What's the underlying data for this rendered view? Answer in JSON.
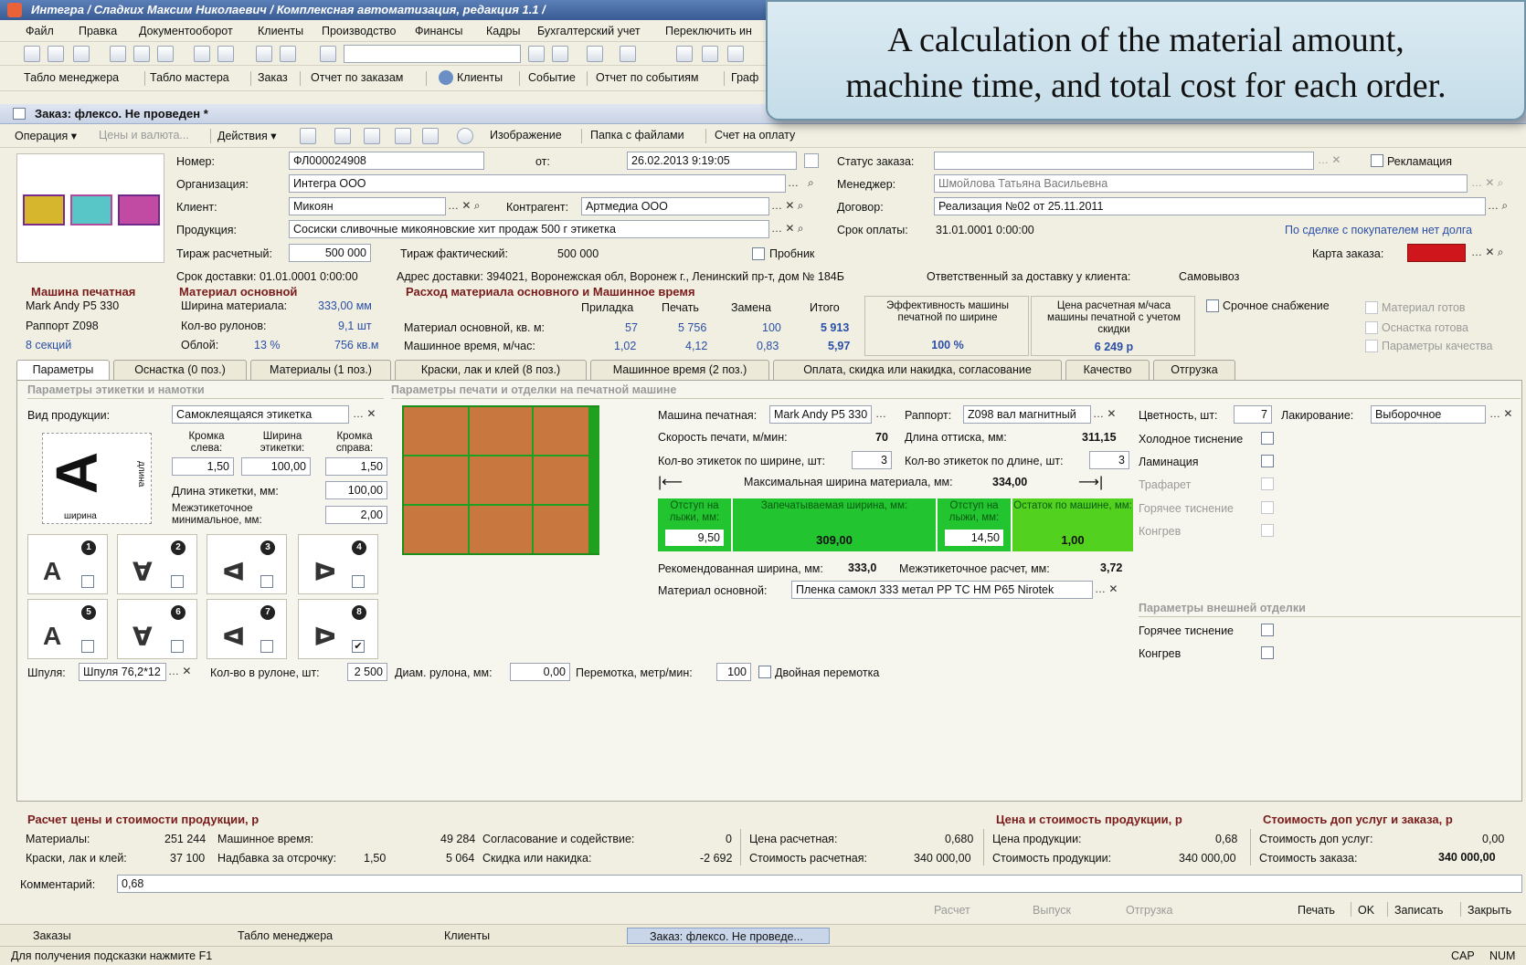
{
  "window": {
    "title": "Интегра / Сладких Максим Николаевич / Комплексная автоматизация, редакция 1.1 /"
  },
  "menu": [
    "Файл",
    "Правка",
    "Документооборот",
    "Клиенты",
    "Производство",
    "Финансы",
    "Кадры",
    "Бухгалтерский учет",
    "Переключить ин"
  ],
  "navbar": [
    "Табло менеджера",
    "Табло мастера",
    "Заказ",
    "Отчет по заказам",
    "Клиенты",
    "Событие",
    "Отчет по событиям",
    "Граф"
  ],
  "document_title": "Заказ: флексо. Не проведен *",
  "opbar": {
    "operation": "Операция ▾",
    "prices": "Цены и валюта...",
    "actions": "Действия ▾",
    "image": "Изображение",
    "folder": "Папка с файлами",
    "invoice": "Счет на оплату"
  },
  "header": {
    "number_label": "Номер:",
    "number": "ФЛ000024908",
    "from_label": "от:",
    "date": "26.02.2013 9:19:05",
    "org_label": "Организация:",
    "org": "Интегра ООО",
    "client_label": "Клиент:",
    "client": "Микоян",
    "counterparty_label": "Контрагент:",
    "counterparty": "Артмедиа ООО",
    "product_label": "Продукция:",
    "product": "Сосиски сливочные микояновские хит продаж 500 г этикетка",
    "run_calc_label": "Тираж расчетный:",
    "run_calc": "500 000",
    "run_fact_label": "Тираж фактический:",
    "run_fact": "500 000",
    "sample_label": "Пробник",
    "delivery_date": "Срок доставки: 01.01.0001 0:00:00",
    "delivery_address": "Адрес доставки: 394021, Воронежская обл, Воронеж г., Ленинский пр-т, дом № 184Б",
    "delivery_responsible": "Ответственный за доставку у клиента:",
    "delivery_resp_value": "Самовывоз",
    "status_label": "Статус заказа:",
    "status": "",
    "claim_label": "Рекламация",
    "manager_label": "Менеджер:",
    "manager": "Шмойлова Татьяна Васильевна",
    "contract_label": "Договор:",
    "contract": "Реализация №02 от 25.11.2011",
    "payment_label": "Срок оплаты:",
    "payment": "31.01.0001 0:00:00",
    "debt_text": "По сделке с покупателем нет долга",
    "card_label": "Карта заказа:"
  },
  "machine_block": {
    "title": "Машина печатная",
    "machine": "Mark Andy P5 330",
    "rapport": "Раппорт Z098",
    "sections": "8  секций"
  },
  "material_block": {
    "title": "Материал основной",
    "width_label": "Ширина материала:",
    "width": "333,00 мм",
    "rolls_label": "Кол-во рулонов:",
    "rolls": "9,1 шт",
    "waste_label": "Облой:",
    "waste_pct": "13 %",
    "waste_area": "756 кв.м"
  },
  "usage_block": {
    "title": "Расход материала основного и Машинное время",
    "cols": [
      "Приладка",
      "Печать",
      "Замена",
      "Итого"
    ],
    "rows": [
      {
        "label": "Материал основной, кв. м:",
        "vals": [
          "57",
          "5 756",
          "100",
          "5 913"
        ]
      },
      {
        "label": "Машинное время, м/час:",
        "vals": [
          "1,02",
          "4,12",
          "0,83",
          "5,97"
        ]
      }
    ]
  },
  "efficiency": {
    "label": "Эффективность машины печатной по ширине",
    "value": "100 %"
  },
  "price_hour": {
    "label": "Цена расчетная м/часа машины печатной с учетом скидки",
    "value": "6 249 р"
  },
  "urgent_label": "Срочное снабжение",
  "ready_flags": [
    "Материал готов",
    "Оснастка готова",
    "Параметры качества"
  ],
  "tabs": [
    "Параметры",
    "Оснастка (0 поз.)",
    "Материалы (1 поз.)",
    "Краски, лак и клей (8 поз.)",
    "Машинное время (2 поз.)",
    "Оплата, скидка или накидка, согласование",
    "Качество",
    "Отгрузка"
  ],
  "label_params": {
    "title": "Параметры этикетки и намотки",
    "type_label": "Вид продукции:",
    "type": "Самоклеящаяся этикетка",
    "edge_left_label": "Кромка слева:",
    "edge_left": "1,50",
    "label_width_label": "Ширина этикетки:",
    "label_width": "100,00",
    "edge_right_label": "Кромка справа:",
    "edge_right": "1,50",
    "label_length_label": "Длина этикетки, мм:",
    "label_length": "100,00",
    "gap_label": "Межэтикеточное минимальное, мм:",
    "gap": "2,00",
    "diagram_letter": "A",
    "diagram_len": "длина",
    "diagram_width": "ширина",
    "rolls": [
      {
        "n": "1",
        "l": "A"
      },
      {
        "n": "2",
        "l": "∀"
      },
      {
        "n": "3",
        "l": "ᐊ"
      },
      {
        "n": "4",
        "l": "ᐅ"
      },
      {
        "n": "5",
        "l": "A"
      },
      {
        "n": "6",
        "l": "∀"
      },
      {
        "n": "7",
        "l": "ᐊ"
      },
      {
        "n": "8",
        "l": "ᐅ"
      }
    ],
    "checked_roll": "✔",
    "core_label": "Шпуля:",
    "core": "Шпуля 76,2*12",
    "per_roll_label": "Кол-во в рулоне, шт:",
    "per_roll": "2 500",
    "diam_label": "Диам. рулона, мм:",
    "diam": "0,00",
    "rewind_label": "Перемотка, метр/мин:",
    "rewind": "100",
    "double_rewind_label": "Двойная перемотка"
  },
  "print_params": {
    "title": "Параметры печати и отделки на печатной машине",
    "machine_label": "Машина печатная:",
    "machine": "Mark Andy P5 330",
    "rapport_label": "Раппорт:",
    "rapport": "Z098 вал магнитный",
    "colors_label": "Цветность, шт:",
    "colors": "7",
    "varnish_label": "Лакирование:",
    "varnish": "Выборочное",
    "speed_label": "Скорость печати, м/мин:",
    "speed": "70",
    "impression_label": "Длина оттиска, мм:",
    "impression": "311,15",
    "across_label": "Кол-во этикеток по ширине, шт:",
    "across": "3",
    "along_label": "Кол-во этикеток по длине, шт:",
    "along": "3",
    "max_width_label": "Максимальная ширина материала, мм:",
    "max_width": "334,00",
    "green": [
      {
        "t": "Отступ на лыжи, мм:",
        "v": "9,50",
        "in": true
      },
      {
        "t": "Запечатываемая ширина, мм:",
        "v": "309,00",
        "in": false
      },
      {
        "t": "Отступ на лыжи, мм:",
        "v": "14,50",
        "in": true
      },
      {
        "t": "Остаток по машине, мм:",
        "v": "1,00",
        "in": false
      }
    ],
    "rec_width_label": "Рекомендованная ширина, мм:",
    "rec_width": "333,0",
    "gap_calc_label": "Межэтикеточное расчет, мм:",
    "gap_calc": "3,72",
    "material_label": "Материал основной:",
    "material": "Пленка самокл 333  метал PP TC HM P65 Nirotek"
  },
  "finishing": {
    "items": [
      "Холодное тиснение",
      "Ламинация",
      "Трафарет",
      "Горячее тиснение",
      "Конгрев"
    ],
    "ext_title": "Параметры внешней отделки",
    "ext_items": [
      "Горячее тиснение",
      "Конгрев"
    ]
  },
  "cost_calc": {
    "title": "Расчет цены и стоимости продукции, р",
    "materials_label": "Материалы:",
    "materials": "251 244",
    "machine_time_label": "Машинное время:",
    "machine_time": "49 284",
    "approval_label": "Согласование и содействие:",
    "approval": "0",
    "paints_label": "Краски, лак и клей:",
    "paints": "37 100",
    "surcharge_label": "Надбавка за отсрочку:",
    "surcharge_pct": "1,50",
    "surcharge": "5 064",
    "discount_label": "Скидка или накидка:",
    "discount": "-2 692",
    "calc_price_label": "Цена расчетная:",
    "calc_price": "0,680",
    "calc_cost_label": "Стоимость расчетная:",
    "calc_cost": "340 000,00"
  },
  "product_price": {
    "title": "Цена и стоимость продукции, р",
    "price_label": "Цена продукции:",
    "price": "0,68",
    "cost_label": "Стоимость продукции:",
    "cost": "340 000,00"
  },
  "extra": {
    "title": "Стоимость доп услуг и заказа, р",
    "services_label": "Стоимость доп услуг:",
    "services": "0,00",
    "order_label": "Стоимость заказа:",
    "order": "340 000,00"
  },
  "comment_label": "Комментарий:",
  "comment": "0,68",
  "footer_buttons": {
    "calc": "Расчет",
    "release": "Выпуск",
    "ship": "Отгрузка",
    "print": "Печать",
    "ok": "OK",
    "save": "Записать",
    "close": "Закрыть"
  },
  "taskbar": [
    "Заказы",
    "Табло менеджера",
    "Клиенты",
    "Заказ: флексо. Не проведе..."
  ],
  "status": {
    "hint": "Для получения подсказки нажмите F1",
    "cap": "CAP",
    "num": "NUM"
  },
  "callout": {
    "line1": "A calculation of the material amount,",
    "line2": "machine time, and total cost for each order."
  },
  "colors": {
    "accent_green": "#22c52f",
    "grid_orange": "#c8783e",
    "group_title": "#7a1b1b",
    "card_red": "#d0161d"
  }
}
